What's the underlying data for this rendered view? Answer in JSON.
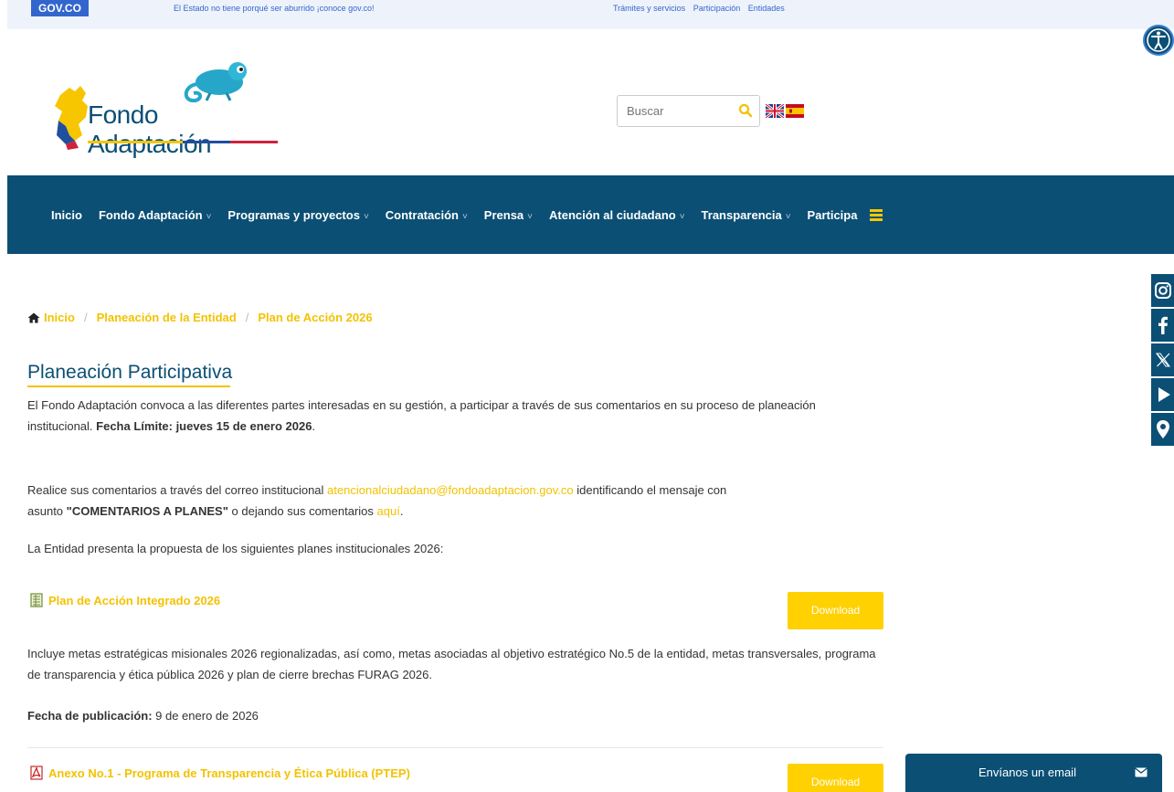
{
  "govbar": {
    "logo": "GOV.CO",
    "tagline": "El Estado no tiene porqué ser aburrido ¡conoce gov.co!",
    "links": [
      "Trámites y servicios",
      "Participación",
      "Entidades"
    ]
  },
  "header": {
    "logo_text": "Fondo Adaptación",
    "search_placeholder": "Buscar"
  },
  "nav": {
    "items": [
      {
        "label": "Inicio",
        "chevron": ""
      },
      {
        "label": "Fondo Adaptación",
        "chevron": "˅"
      },
      {
        "label": "Programas y proyectos",
        "chevron": "˅"
      },
      {
        "label": "Contratación",
        "chevron": "˅"
      },
      {
        "label": "Prensa",
        "chevron": "˅"
      },
      {
        "label": "Atención al ciudadano",
        "chevron": "˅"
      },
      {
        "label": "Transparencia",
        "chevron": "˅"
      },
      {
        "label": "Participa",
        "chevron": ""
      }
    ]
  },
  "breadcrumb": {
    "home": "Inicio",
    "level2": "Planeación de la Entidad",
    "level3": "Plan de Acción 2026",
    "sep": "/"
  },
  "content": {
    "title": "Planeación Participativa",
    "p1_a": "El Fondo Adaptación convoca a las diferentes partes interesadas en su gestión, a participar a través de sus comentarios en su proceso de planeación institucional. ",
    "p1_bold": "Fecha Límite: jueves 15 de enero 2026",
    "p1_end": ".",
    "p2_a": "Realice sus comentarios a través del correo institucional ",
    "p2_email": "atencionalciudadano@fondoadaptacion.gov.co",
    "p2_b": " identificando el mensaje con",
    "p2_c": "asunto ",
    "p2_bold": "\"COMENTARIOS A PLANES\"",
    "p2_d": " o dejando sus comentarios ",
    "p2_link": "aquí",
    "p2_end": ".",
    "p3": "La Entidad presenta la propuesta de los siguientes planes institucionales 2026:"
  },
  "documents": [
    {
      "title": "Plan de Acción Integrado 2026",
      "button": "Download",
      "description": "Incluye metas estratégicas misionales 2026 regionalizadas, así como, metas asociadas al objetivo estratégico No.5 de la entidad, metas transversales, programa de transparencia y ética pública 2026 y plan de cierre brechas FURAG 2026.",
      "date_label": "Fecha de publicación:",
      "date_value": " 9 de enero de 2026"
    },
    {
      "title": "Anexo No.1 - Programa de Transparencia y Ética Pública (PTEP)",
      "button": "Download"
    }
  ],
  "email_widget": {
    "label": "Envíanos un email"
  },
  "colors": {
    "navy": "#0b4f75",
    "yellow": "#f3c200",
    "button": "#ffd100",
    "govblue": "#3366cc"
  }
}
